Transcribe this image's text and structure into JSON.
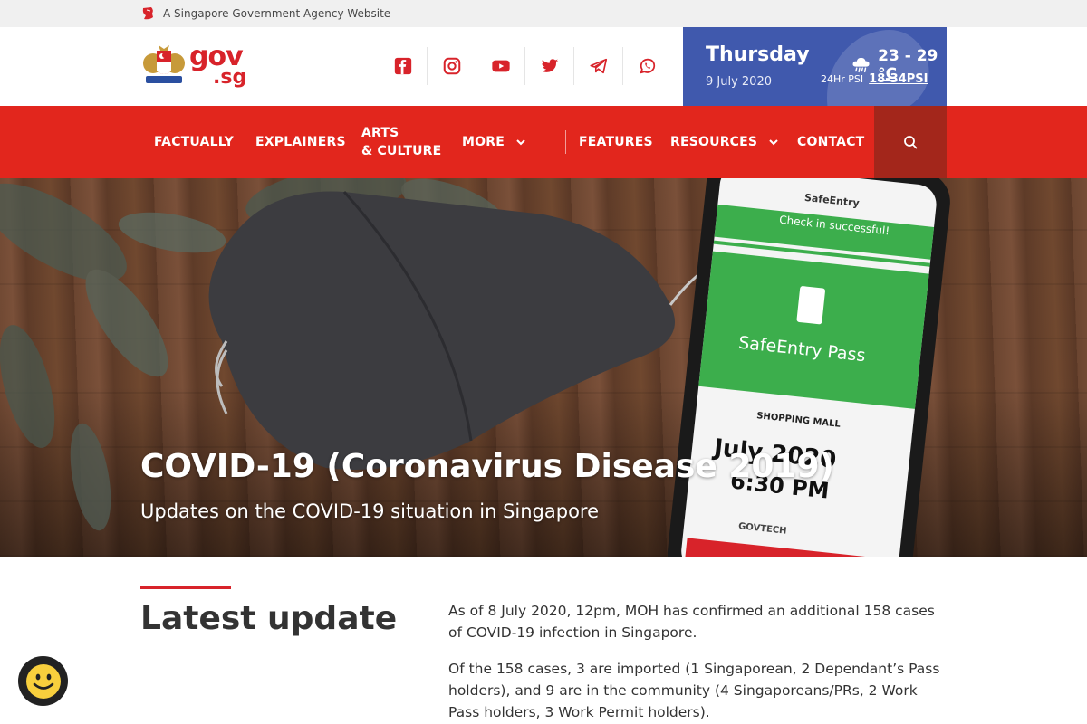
{
  "masthead": {
    "text": "A Singapore Government Agency Website"
  },
  "logo": {
    "gov": "gov",
    "sg": ".sg"
  },
  "socials": [
    "facebook-icon",
    "instagram-icon",
    "youtube-icon",
    "twitter-icon",
    "telegram-icon",
    "whatsapp-icon"
  ],
  "weather": {
    "day": "Thursday",
    "date": "9 July 2020",
    "temp": "23 - 29 °C",
    "psi_label": "24Hr PSI",
    "psi_value": "18-34PSI",
    "icon": "rain-cloud-icon"
  },
  "nav": {
    "factually": "FACTUALLY",
    "explainers": "EXPLAINERS",
    "arts_line1": "ARTS",
    "arts_line2": "& CULTURE",
    "more": "MORE",
    "features": "FEATURES",
    "resources": "RESOURCES",
    "contact": "CONTACT"
  },
  "hero": {
    "title": "COVID-19 (Coronavirus Disease 2019)",
    "subtitle": "Updates on the COVID-19 situation in Singapore",
    "phone": {
      "app": "SafeEntry",
      "check": "Check in successful!",
      "pass": "SafeEntry Pass",
      "venue": "SHOPPING MALL",
      "date": "July 2020",
      "time": "6:30 PM",
      "brand": "GOVTECH"
    }
  },
  "content": {
    "title": "Latest update",
    "para1": "As of 8 July 2020, 12pm, MOH has confirmed an additional 158 cases of COVID-19 infection in Singapore.",
    "para2": "Of the 158 cases, 3 are imported (1 Singaporean, 2 Dependant’s Pass holders), and 9 are in the community (4 Singaporeans/PRs, 2 Work Pass holders, 3 Work Permit holders)."
  },
  "colors": {
    "brand_red": "#e2261d",
    "dark_red": "#a3261b",
    "weather_blue": "#4059ad"
  }
}
